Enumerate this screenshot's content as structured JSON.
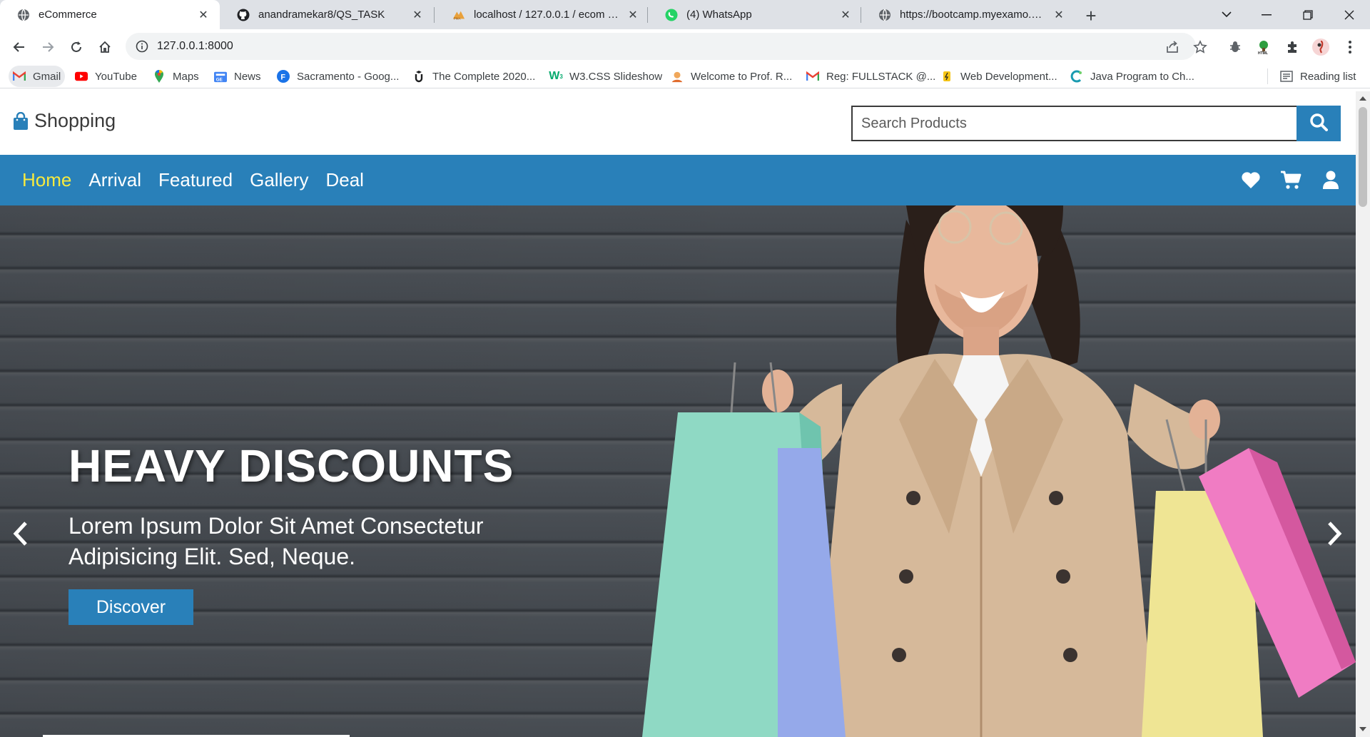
{
  "browser": {
    "tabs": [
      {
        "title": "eCommerce",
        "favicon": "globe-icon",
        "active": true
      },
      {
        "title": "anandramekar8/QS_TASK",
        "favicon": "github-icon",
        "active": false
      },
      {
        "title": "localhost / 127.0.0.1 / ecom / cat",
        "favicon": "phpmyadmin-icon",
        "active": false
      },
      {
        "title": "(4) WhatsApp",
        "favicon": "whatsapp-icon",
        "active": false
      },
      {
        "title": "https://bootcamp.myexamo.com",
        "favicon": "globe-icon",
        "active": false
      }
    ],
    "url": "127.0.0.1:8000",
    "bookmarks": [
      {
        "label": "Gmail",
        "icon": "gmail-icon"
      },
      {
        "label": "YouTube",
        "icon": "youtube-icon"
      },
      {
        "label": "Maps",
        "icon": "maps-icon"
      },
      {
        "label": "News",
        "icon": "news-icon"
      },
      {
        "label": "Sacramento - Goog...",
        "icon": "f-icon"
      },
      {
        "label": "The Complete 2020...",
        "icon": "u-icon"
      },
      {
        "label": "W3.CSS Slideshow",
        "icon": "w3-icon"
      },
      {
        "label": "Welcome to Prof. R...",
        "icon": "prof-icon"
      },
      {
        "label": "Reg: FULLSTACK @...",
        "icon": "gmail-icon"
      },
      {
        "label": "Web Development...",
        "icon": "bolt-icon"
      },
      {
        "label": "Java Program to Ch...",
        "icon": "c-icon"
      }
    ],
    "reading_list": "Reading list"
  },
  "site": {
    "logo": "Shopping",
    "search_placeholder": "Search Products",
    "nav": [
      "Home",
      "Arrival",
      "Featured",
      "Gallery",
      "Deal"
    ],
    "nav_icons": [
      "heart-icon",
      "cart-icon",
      "user-icon"
    ],
    "accent": "#2980b9",
    "active_nav_color": "#f7ea3e"
  },
  "hero": {
    "heading": "HEAVY DISCOUNTS",
    "text": "Lorem Ipsum Dolor Sit Amet Consectetur Adipisicing Elit. Sed, Neque.",
    "button": "Discover"
  }
}
